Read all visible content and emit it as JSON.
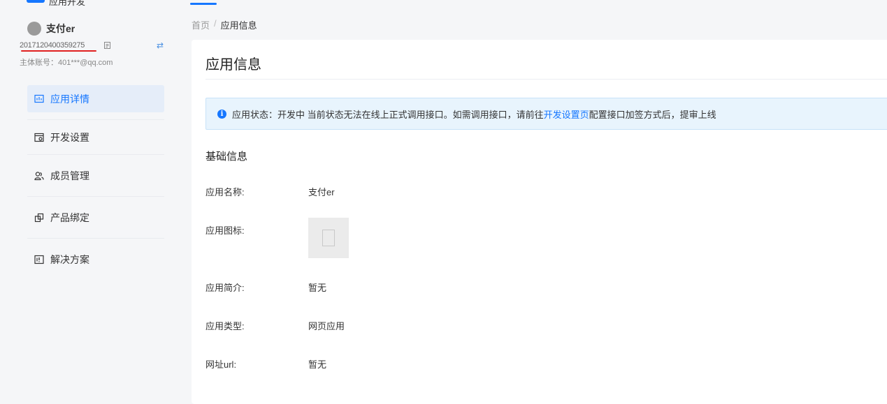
{
  "header": {
    "logo_text": "应用开发"
  },
  "sidebar": {
    "app_name": "支付er",
    "app_id": "2017120400359275",
    "account_line": "主体账号：401***@qq.com",
    "items": [
      {
        "label": "应用详情",
        "icon": "dashboard-icon"
      },
      {
        "label": "开发设置",
        "icon": "settings-browser-icon"
      },
      {
        "label": "成员管理",
        "icon": "members-icon"
      },
      {
        "label": "产品绑定",
        "icon": "product-link-icon"
      },
      {
        "label": "解决方案",
        "icon": "solution-icon"
      }
    ]
  },
  "breadcrumb": {
    "home": "首页",
    "separator": "/",
    "current": "应用信息"
  },
  "main": {
    "title": "应用信息",
    "alert": {
      "prefix": "应用状态：开发中 当前状态无法在线上正式调用接口。如需调用接口，请前往",
      "link": "开发设置页",
      "suffix": "配置接口加签方式后，提审上线"
    },
    "section_title": "基础信息",
    "fields": [
      {
        "label": "应用名称:",
        "value": "支付er"
      },
      {
        "label": "应用图标:",
        "value": ""
      },
      {
        "label": "应用简介:",
        "value": "暂无"
      },
      {
        "label": "应用类型:",
        "value": "网页应用"
      },
      {
        "label": "网址url:",
        "value": "暂无"
      }
    ]
  },
  "colors": {
    "accent": "#1677ff",
    "underline": "#e02020"
  }
}
